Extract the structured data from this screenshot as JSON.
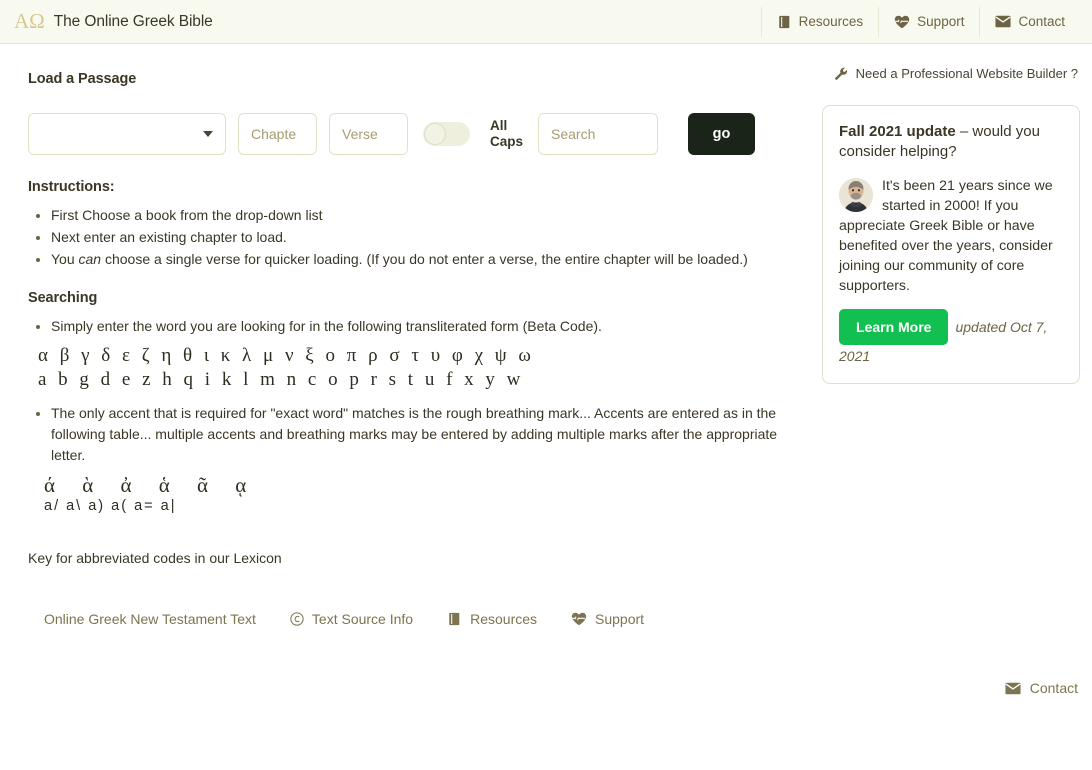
{
  "header": {
    "logo": "ΑΩ",
    "title": "The Online Greek Bible",
    "nav": [
      {
        "label": "Resources",
        "icon": "book-icon"
      },
      {
        "label": "Support",
        "icon": "heart-pulse-icon"
      },
      {
        "label": "Contact",
        "icon": "envelope-icon"
      }
    ]
  },
  "form": {
    "heading": "Load a Passage",
    "book_select_value": "",
    "chapter_placeholder": "Chapte",
    "verse_placeholder": "Verse",
    "allcaps_label": "All Caps",
    "allcaps_state": "off",
    "search_placeholder": "Search",
    "go_label": "go"
  },
  "instructions": {
    "heading": "Instructions:",
    "items": [
      "First Choose a book from the drop-down list",
      "Next enter an existing chapter to load.",
      "You can choose a single verse for quicker loading. (If you do not enter a verse, the entire chapter will be loaded.)"
    ],
    "item3_pre": "You ",
    "item3_em": "can",
    "item3_post": " choose a single verse for quicker loading. (If you do not enter a verse, the entire chapter will be loaded.)"
  },
  "searching": {
    "heading": "Searching",
    "bullet1": "Simply enter the word you are looking for in the following transliterated form (Beta Code).",
    "greek_letters": "α β γ δ ε ζ η θ ι κ λ μ ν ξ ο π ρ σ τ υ φ χ ψ ω",
    "beta_letters": "a b g d e z h q i k l m n c o p r s t u f x y w",
    "bullet2": "The only accent that is required for \"exact word\" matches is the rough breathing mark... Accents are entered as in the following table... multiple accents and breathing marks may be entered by adding multiple marks after the appropriate letter.",
    "accent_glyphs": "ά ὰ ἀ ἁ ᾶ ᾳ",
    "accent_codes": "a/ a\\ a) a( a= a|",
    "lexicon_key": "Key for abbreviated codes in our Lexicon"
  },
  "footer": {
    "links": [
      {
        "label": "Online Greek New Testament Text",
        "icon": ""
      },
      {
        "label": "Text Source Info",
        "icon": "copyright-icon"
      },
      {
        "label": "Resources",
        "icon": "book-icon"
      },
      {
        "label": "Support",
        "icon": "heart-pulse-icon"
      }
    ],
    "contact": {
      "label": "Contact",
      "icon": "envelope-icon"
    }
  },
  "sidebar": {
    "builder_link": "Need a Professional Website Builder ?",
    "builder_icon": "wrench-icon",
    "promo": {
      "title_bold": "Fall 2021 update",
      "title_rest": " – would you consider helping?",
      "body": "It's been 21 years since we started in 2000! If you appreciate Greek Bible or have benefited over the years, consider joining our community of core supporters.",
      "cta_label": "Learn More",
      "updated": "updated Oct 7, 2021",
      "avatar": "avatar-photo"
    }
  },
  "colors": {
    "header_bg": "#f8faef",
    "accent_gold": "#d8c894",
    "text_dark": "#3b3726",
    "muted_olive": "#7d7450",
    "go_button": "#1b2418",
    "cta_green": "#11c050",
    "field_border": "#e0e2c4"
  }
}
